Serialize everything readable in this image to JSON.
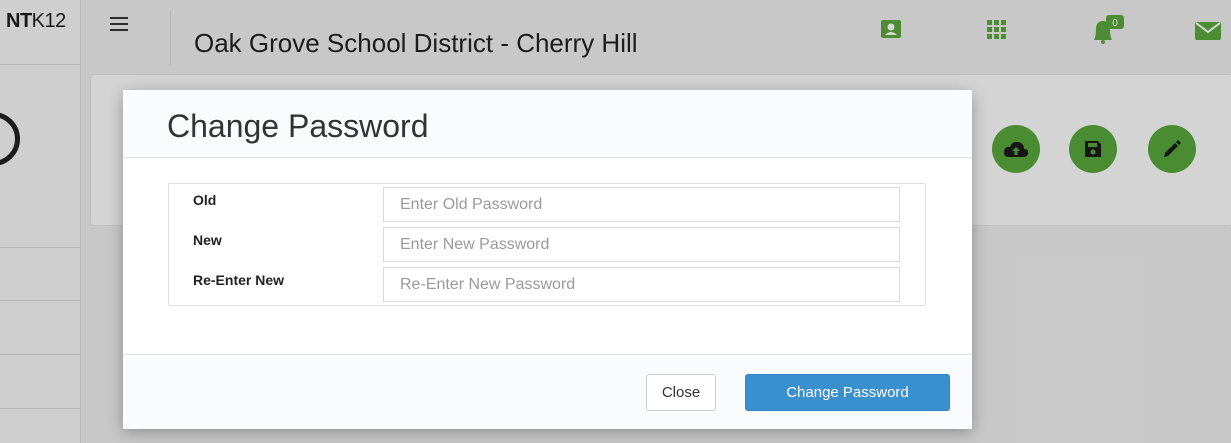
{
  "app": {
    "logo_bold": "NT",
    "logo_light": "K12",
    "title": "Oak Grove School District - Cherry Hill",
    "notification_count": "0",
    "icon_color": "#5aa63d"
  },
  "header_icons": [
    "contact-card-icon",
    "apps-grid-icon",
    "notification-bell-icon",
    "mail-icon"
  ],
  "action_buttons": [
    "cloud-upload-icon",
    "save-icon",
    "edit-pencil-icon"
  ],
  "modal": {
    "title": "Change Password",
    "fields": [
      {
        "label": "Old",
        "placeholder": "Enter Old Password",
        "value": ""
      },
      {
        "label": "New",
        "placeholder": "Enter New Password",
        "value": ""
      },
      {
        "label": "Re-Enter New",
        "placeholder": "Re-Enter New Password",
        "value": ""
      }
    ],
    "close_label": "Close",
    "submit_label": "Change Password",
    "primary_color": "#3a8fcf"
  }
}
